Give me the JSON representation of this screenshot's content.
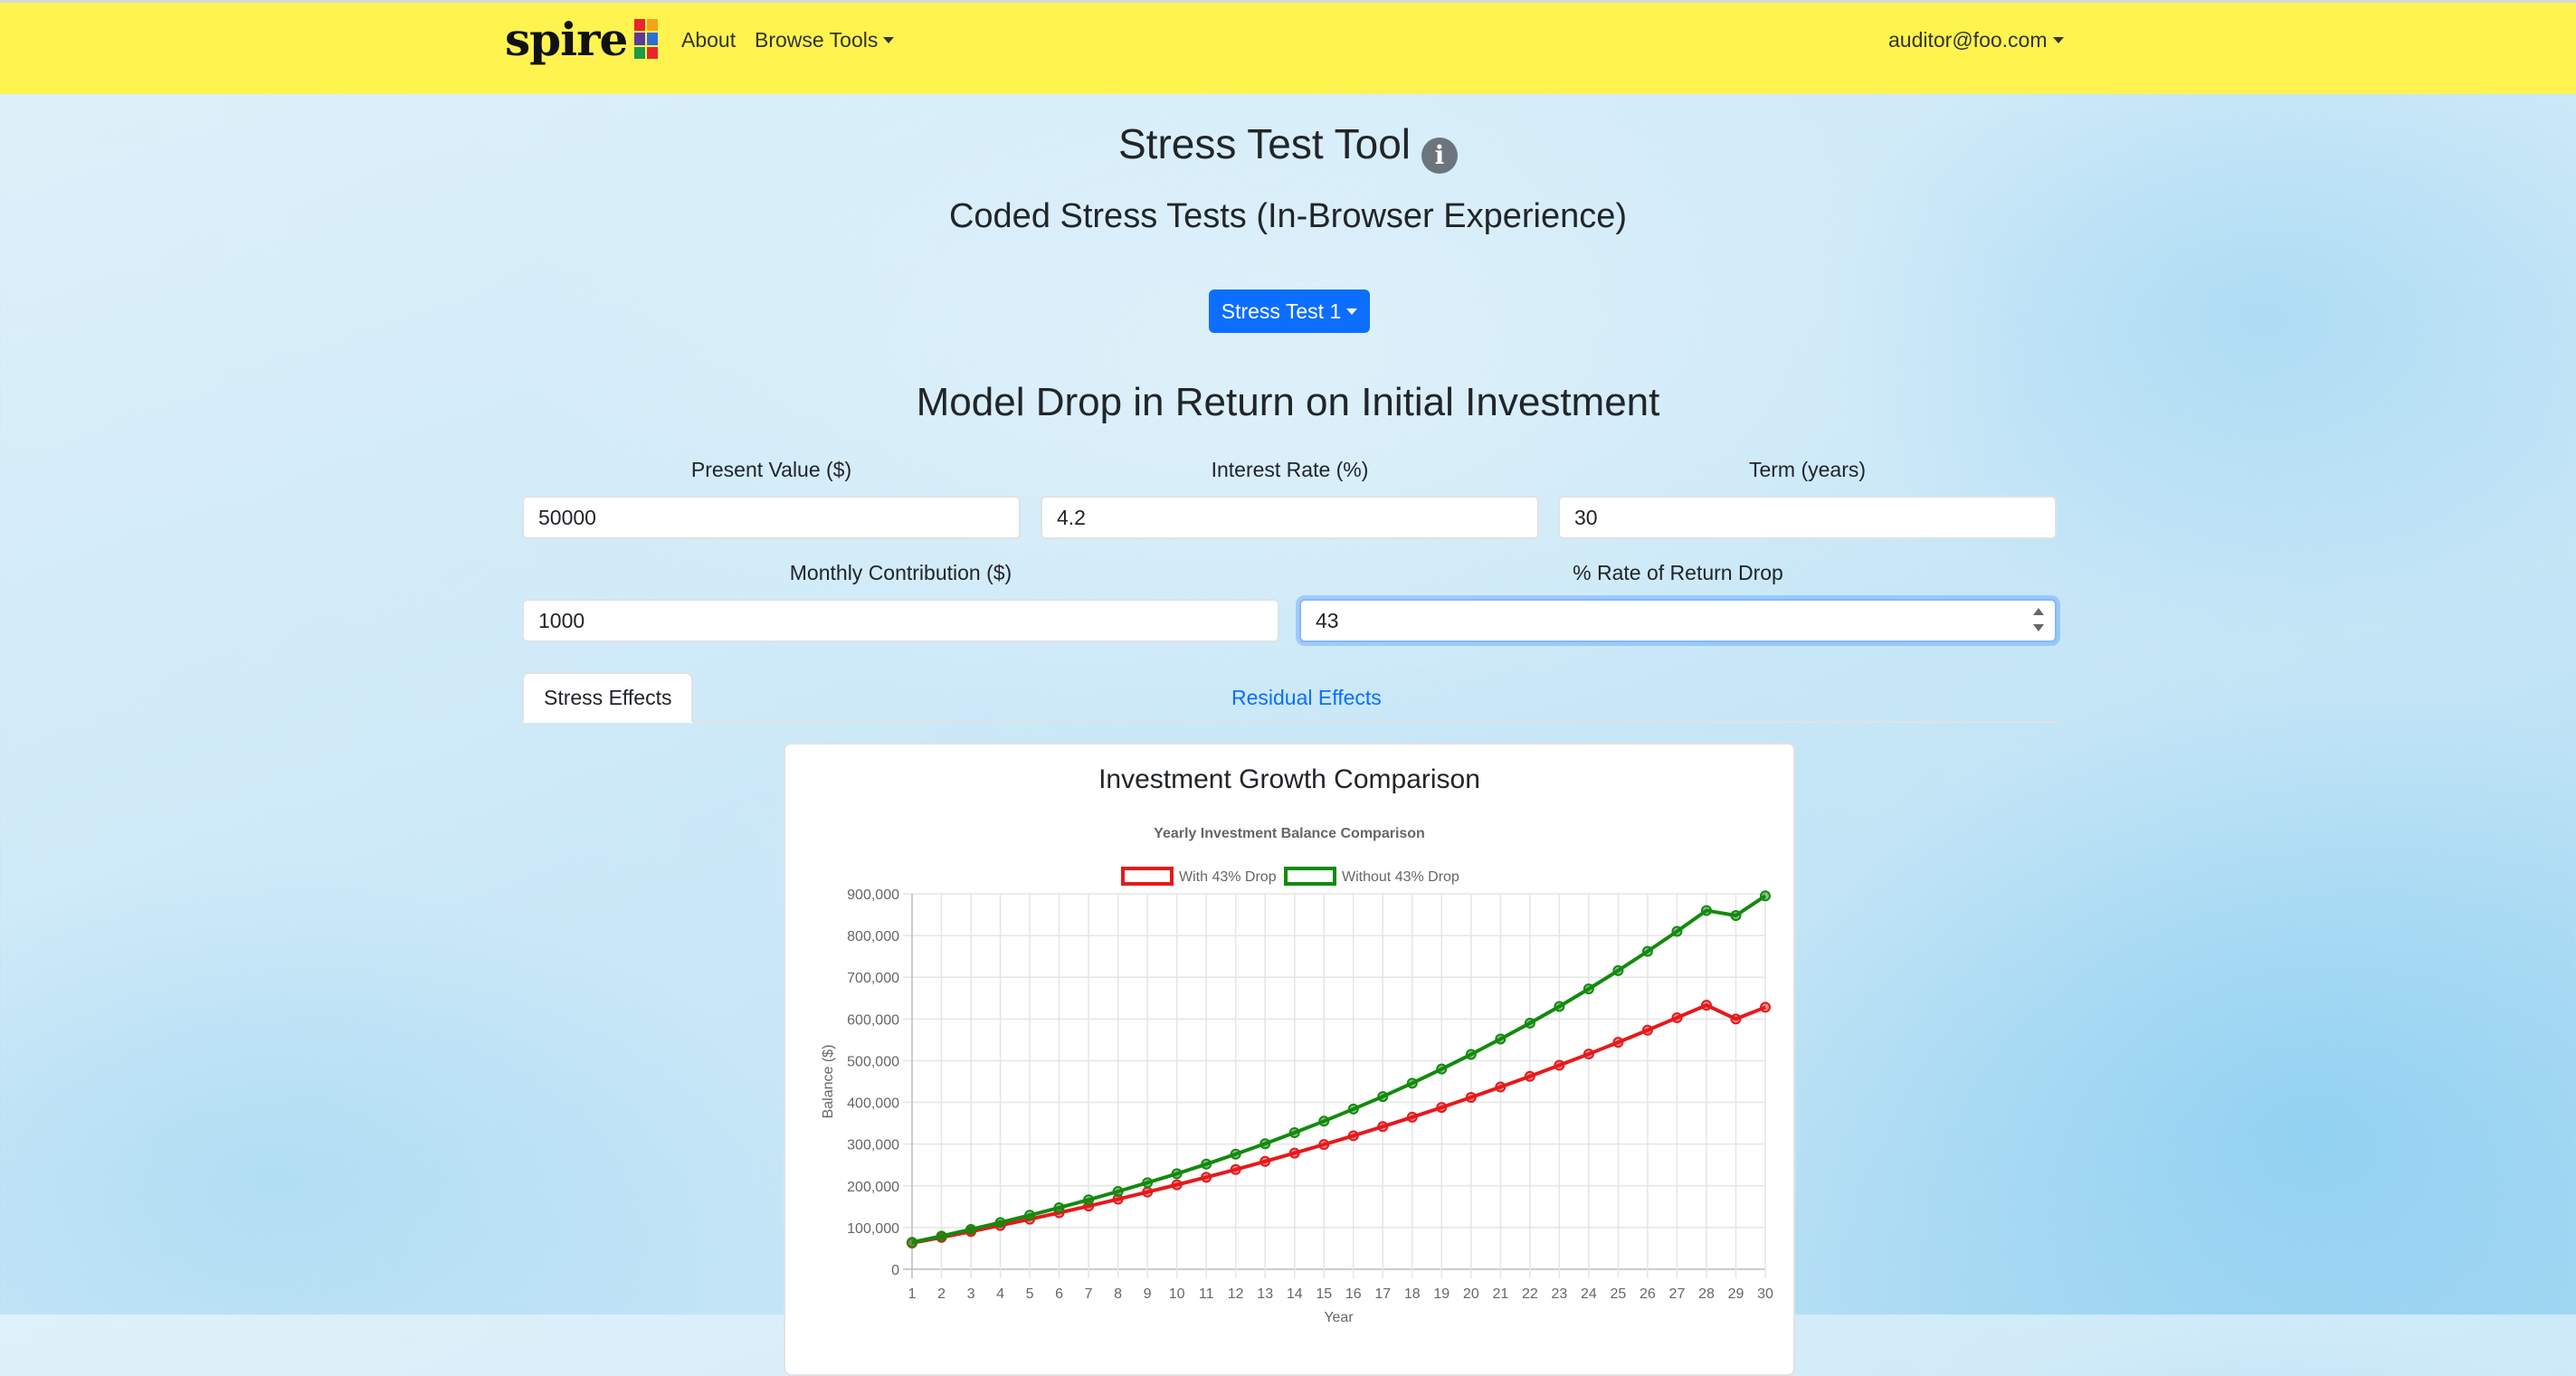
{
  "nav": {
    "brand": "spire",
    "about": "About",
    "browse_tools": "Browse Tools",
    "user": "auditor@foo.com"
  },
  "page": {
    "title": "Stress Test Tool",
    "subtitle": "Coded Stress Tests (In-Browser Experience)",
    "dropdown_label": "Stress Test 1",
    "section_title": "Model Drop in Return on Initial Investment"
  },
  "form": {
    "present_value": {
      "label": "Present Value ($)",
      "value": "50000"
    },
    "interest_rate": {
      "label": "Interest Rate (%)",
      "value": "4.2"
    },
    "term": {
      "label": "Term (years)",
      "value": "30"
    },
    "monthly_contribution": {
      "label": "Monthly Contribution ($)",
      "value": "1000"
    },
    "rate_drop": {
      "label": "% Rate of Return Drop",
      "value": "43"
    }
  },
  "tabs": [
    {
      "label": "Stress Effects",
      "active": true
    },
    {
      "label": "Residual Effects",
      "active": false
    }
  ],
  "card": {
    "title": "Investment Growth Comparison"
  },
  "colors": {
    "navbar": "#fff44f",
    "primary": "#0d6efd",
    "series_drop": "#e6191b",
    "series_nodrop": "#138a0e"
  },
  "chart_data": {
    "type": "line",
    "title": "Yearly Investment Balance Comparison",
    "xlabel": "Year",
    "ylabel": "Balance ($)",
    "ylim": [
      0,
      900000
    ],
    "yticks": [
      0,
      100000,
      200000,
      300000,
      400000,
      500000,
      600000,
      700000,
      800000,
      900000
    ],
    "ytick_labels": [
      "0",
      "100,000",
      "200,000",
      "300,000",
      "400,000",
      "500,000",
      "600,000",
      "700,000",
      "800,000",
      "900,000"
    ],
    "x": [
      1,
      2,
      3,
      4,
      5,
      6,
      7,
      8,
      9,
      10,
      11,
      12,
      13,
      14,
      15,
      16,
      17,
      18,
      19,
      20,
      21,
      22,
      23,
      24,
      25,
      26,
      27,
      28,
      29,
      30
    ],
    "grid": true,
    "legend_position": "top-center",
    "series": [
      {
        "name": "With 43% Drop",
        "color": "#e6191b",
        "values": [
          63000,
          76500,
          90500,
          105000,
          120000,
          135500,
          151500,
          168000,
          185000,
          202500,
          220500,
          239000,
          258500,
          278500,
          299000,
          320000,
          342000,
          364500,
          388000,
          412000,
          437000,
          462500,
          489000,
          516000,
          544000,
          573000,
          603000,
          633000,
          600000,
          628000
        ]
      },
      {
        "name": "Without 43% Drop",
        "color": "#138a0e",
        "values": [
          64500,
          79500,
          95500,
          112000,
          129500,
          147500,
          166500,
          186500,
          207500,
          229000,
          252000,
          276000,
          301000,
          327500,
          355000,
          384000,
          414000,
          446000,
          480000,
          515000,
          552000,
          590000,
          630000,
          672000,
          716000,
          762000,
          810000,
          860000,
          848000,
          895000
        ]
      }
    ]
  }
}
